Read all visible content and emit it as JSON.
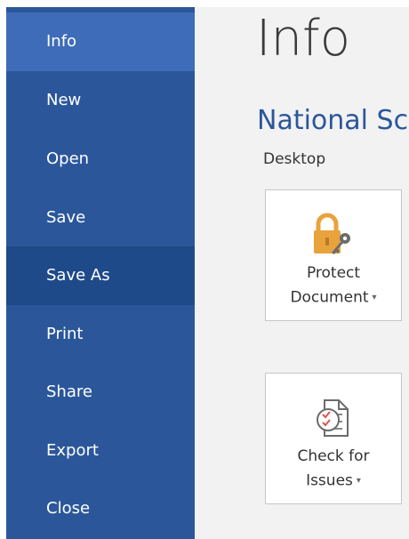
{
  "backstage": {
    "nav": {
      "items": [
        {
          "label": "Info",
          "state": "active"
        },
        {
          "label": "New",
          "state": "normal"
        },
        {
          "label": "Open",
          "state": "normal"
        },
        {
          "label": "Save",
          "state": "normal"
        },
        {
          "label": "Save As",
          "state": "hover"
        },
        {
          "label": "Print",
          "state": "normal"
        },
        {
          "label": "Share",
          "state": "normal"
        },
        {
          "label": "Export",
          "state": "normal"
        },
        {
          "label": "Close",
          "state": "normal"
        }
      ]
    },
    "main": {
      "page_title": "Info",
      "document_title": "National Sc",
      "location": "Desktop",
      "tiles": {
        "protect": {
          "line1": "Protect",
          "line2": "Document",
          "icon": "padlock-key-icon"
        },
        "check": {
          "line1": "Check for",
          "line2": "Issues",
          "icon": "checklist-inspect-icon"
        }
      }
    }
  },
  "colors": {
    "nav_background": "#2b579a",
    "nav_active": "#3e6cb8",
    "nav_hover": "#1f4a8a",
    "content_background": "#f2f2f2",
    "accent_title": "#2b579a",
    "padlock": "#e8a33d"
  },
  "icons": {
    "dropdown": "▾"
  }
}
